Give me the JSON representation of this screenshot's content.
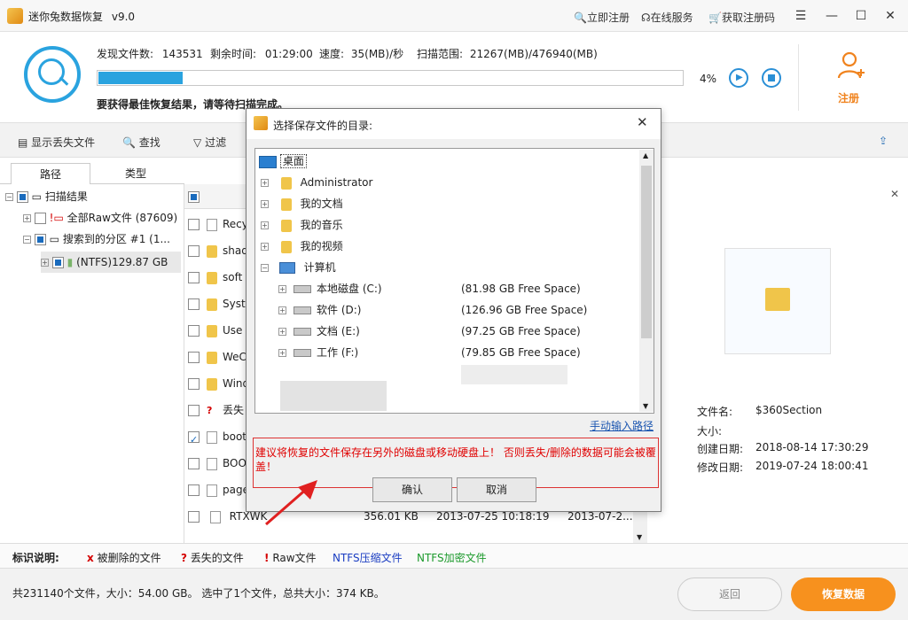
{
  "app": {
    "title": "迷你兔数据恢复",
    "version": "v9.0"
  },
  "titlebar_links": {
    "register": "立即注册",
    "online_service": "在线服务",
    "get_code": "获取注册码"
  },
  "window_controls": {
    "menu": "☰",
    "minimize": "—",
    "maximize": "☐",
    "close": "✕"
  },
  "scan": {
    "found_label": "发现文件数:",
    "found_value": "143531",
    "remaining_label": "剩余时间:",
    "remaining_value": "01:29:00",
    "speed_label": "速度:",
    "speed_value": "35(MB)/秒",
    "range_label": "扫描范围:",
    "range_value": "21267(MB)/476940(MB)",
    "progress_percent": 4,
    "progress_text": "4%",
    "message": "要获得最佳恢复结果，请等待扫描完成。"
  },
  "register_label": "注册",
  "toolbar": {
    "show_lost": "显示丢失文件",
    "find": "查找",
    "filter": "过滤"
  },
  "tabs": {
    "path": "路径",
    "type": "类型"
  },
  "tree": {
    "root": "扫描结果",
    "raw": "全部Raw文件 (87609)",
    "partition": "搜索到的分区 #1 (1...",
    "ntfs": "(NTFS)129.87 GB"
  },
  "files": [
    {
      "name": "Recy",
      "icon": "recycle"
    },
    {
      "name": "shad",
      "icon": "folder"
    },
    {
      "name": "soft",
      "icon": "folder"
    },
    {
      "name": "Syst",
      "icon": "folder"
    },
    {
      "name": "Use",
      "icon": "folder"
    },
    {
      "name": "WeC",
      "icon": "folder"
    },
    {
      "name": "Wind",
      "icon": "folder"
    },
    {
      "name": "丢失",
      "icon": "lost"
    },
    {
      "name": "boot",
      "icon": "doc"
    },
    {
      "name": "BOO",
      "icon": "doc"
    },
    {
      "name": "page",
      "icon": "doc"
    }
  ],
  "last_row": {
    "name": "RTXWK",
    "size": "356.01 KB",
    "date1": "2013-07-25 10:18:19",
    "date2": "2013-07-2..."
  },
  "preview": {
    "filename_label": "文件名:",
    "filename": "$360Section",
    "size_label": "大小:",
    "created_label": "创建日期:",
    "created": "2018-08-14 17:30:29",
    "modified_label": "修改日期:",
    "modified": "2019-07-24 18:00:41"
  },
  "legend": {
    "title": "标识说明:",
    "deleted_mark": "x",
    "deleted": "被删除的文件",
    "lost_mark": "?",
    "lost": "丢失的文件",
    "raw_mark": "!",
    "raw": "Raw文件",
    "ntfs_compressed": "NTFS压缩文件",
    "ntfs_encrypted": "NTFS加密文件"
  },
  "status": {
    "text": "共231140个文件，大小：54.00 GB。 选中了1个文件，总共大小：374 KB。",
    "back": "返回",
    "recover": "恢复数据"
  },
  "dialog": {
    "title": "选择保存文件的目录:",
    "desktop": "桌面",
    "admin": "Administrator",
    "documents": "我的文档",
    "music": "我的音乐",
    "videos": "我的视频",
    "computer": "计算机",
    "drives": [
      {
        "name": "本地磁盘 (C:)",
        "free": "(81.98 GB Free Space)"
      },
      {
        "name": "软件 (D:)",
        "free": "(126.96 GB Free Space)"
      },
      {
        "name": "文档 (E:)",
        "free": "(97.25 GB Free Space)"
      },
      {
        "name": "工作 (F:)",
        "free": "(79.85 GB Free Space)"
      }
    ],
    "manual_path": "手动输入路径",
    "warning": "建议将恢复的文件保存在另外的磁盘或移动硬盘上！ 否则丢失/删除的数据可能会被覆盖！",
    "ok": "确认",
    "cancel": "取消"
  },
  "colors": {
    "accent": "#2aa3df",
    "orange": "#f7911e",
    "warning": "#e00000"
  }
}
